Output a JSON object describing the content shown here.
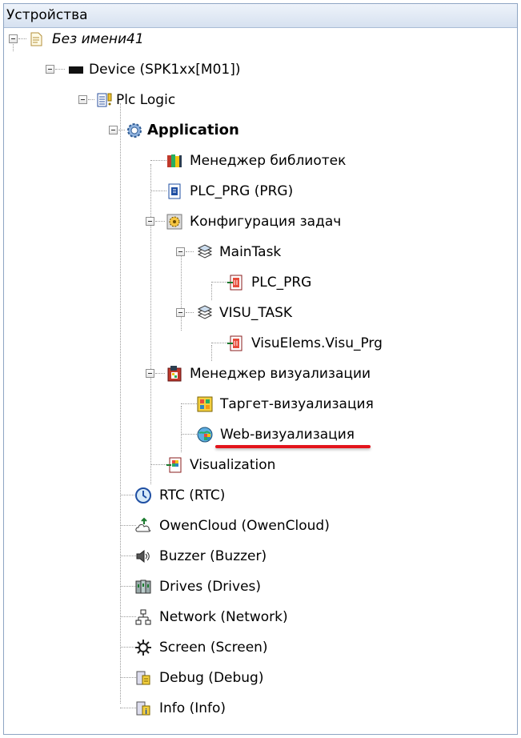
{
  "panel": {
    "title": "Устройства"
  },
  "tree": [
    {
      "label": "Без имени41",
      "icon": "project-icon"
    },
    {
      "label": "Device (SPK1xx[M01])",
      "icon": "device-icon"
    },
    {
      "label": "Plc Logic",
      "icon": "plc-logic-icon"
    },
    {
      "label": "Application",
      "icon": "application-gear-icon"
    },
    {
      "label": "Менеджер библиотек",
      "icon": "library-books-icon"
    },
    {
      "label": "PLC_PRG (PRG)",
      "icon": "pou-icon"
    },
    {
      "label": "Конфигурация задач",
      "icon": "task-config-icon"
    },
    {
      "label": "MainTask",
      "icon": "task-icon"
    },
    {
      "label": "PLC_PRG",
      "icon": "program-call-icon"
    },
    {
      "label": "VISU_TASK",
      "icon": "task-icon"
    },
    {
      "label": "VisuElems.Visu_Prg",
      "icon": "program-call-icon"
    },
    {
      "label": "Менеджер визуализации",
      "icon": "visu-manager-icon"
    },
    {
      "label": "Таргет-визуализация",
      "icon": "target-visu-icon"
    },
    {
      "label": "Web-визуализация",
      "icon": "web-visu-icon"
    },
    {
      "label": "Visualization",
      "icon": "visualization-icon"
    },
    {
      "label": "RTC (RTC)",
      "icon": "clock-icon"
    },
    {
      "label": "OwenCloud (OwenCloud)",
      "icon": "cloud-icon"
    },
    {
      "label": "Buzzer (Buzzer)",
      "icon": "speaker-icon"
    },
    {
      "label": "Drives (Drives)",
      "icon": "drives-icon"
    },
    {
      "label": "Network (Network)",
      "icon": "network-icon"
    },
    {
      "label": "Screen (Screen)",
      "icon": "screen-icon"
    },
    {
      "label": "Debug (Debug)",
      "icon": "debug-icon"
    },
    {
      "label": "Info (Info)",
      "icon": "info-icon"
    }
  ],
  "colors": {
    "highlight_underline": "#e3141c",
    "header_bg": "#dbe5f2"
  }
}
